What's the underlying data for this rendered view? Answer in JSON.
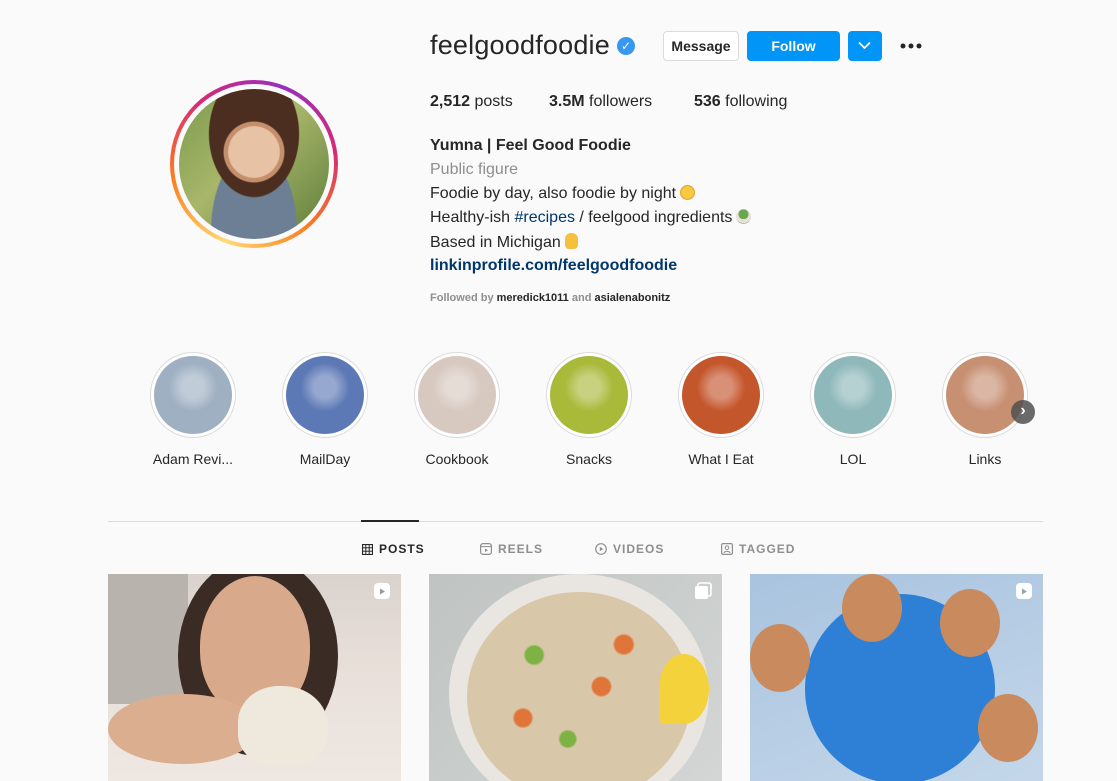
{
  "profile": {
    "username": "feelgoodfoodie",
    "verified": true,
    "message_label": "Message",
    "follow_label": "Follow"
  },
  "stats": {
    "posts_count": "2,512",
    "posts_label": "posts",
    "followers_count": "3.5M",
    "followers_label": "followers",
    "following_count": "536",
    "following_label": "following"
  },
  "bio": {
    "name": "Yumna | Feel Good Foodie",
    "category": "Public figure",
    "line1": "Foodie by day, also foodie by night",
    "line2_prefix": "Healthy-ish ",
    "line2_hashtag": "#recipes",
    "line2_suffix": " / feelgood ingredients",
    "line3": "Based in Michigan",
    "link": "linkinprofile.com/feelgoodfoodie",
    "followed_by_prefix": "Followed by ",
    "followed_by_user1": "meredick1011",
    "followed_by_and": " and ",
    "followed_by_user2": "asialenabonitz"
  },
  "highlights": [
    {
      "label": "Adam Revi...",
      "color": "#9fb0c3"
    },
    {
      "label": "MailDay",
      "color": "#5d79b5"
    },
    {
      "label": "Cookbook",
      "color": "#d7c9c0"
    },
    {
      "label": "Snacks",
      "color": "#a9b93a"
    },
    {
      "label": "What I Eat",
      "color": "#c4562c"
    },
    {
      "label": "LOL",
      "color": "#8fb8ba"
    },
    {
      "label": "Links",
      "color": "#c79073"
    }
  ],
  "tabs": {
    "posts": "POSTS",
    "reels": "REELS",
    "videos": "VIDEOS",
    "tagged": "TAGGED"
  },
  "colors": {
    "accent": "#0095f6",
    "link": "#00376b",
    "muted": "#8e8e8e"
  }
}
